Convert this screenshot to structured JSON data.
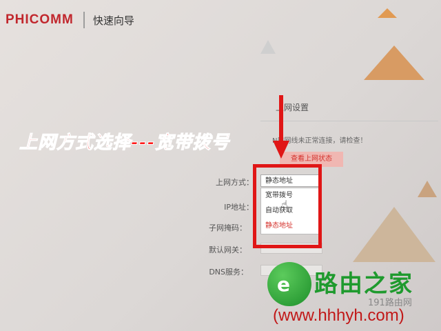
{
  "header": {
    "logo": "PHICOMM",
    "title": "快速向导"
  },
  "section": {
    "title": "上网设置",
    "warning": "N口网线未正常连接，请检查！",
    "check_button": "查看上网状态"
  },
  "form": {
    "connection_label": "上网方式：",
    "connection_value": "静态地址",
    "ip_label": "IP地址：",
    "mask_label": "子网掩码：",
    "gateway_label": "默认网关：",
    "dns_label": "DNS服务："
  },
  "dropdown": {
    "options": [
      "宽带拨号",
      "自动获取",
      "静态地址"
    ]
  },
  "annotation": {
    "text": "上网方式选择---宽带拨号"
  },
  "watermark": {
    "logo_char": "e",
    "title": "路由之家",
    "sub": "191路由网",
    "url": "(www.hhhyh.com)"
  },
  "colors": {
    "brand": "#c1272d",
    "annotation": "#e01616",
    "watermark_green": "#1f9a2e"
  }
}
